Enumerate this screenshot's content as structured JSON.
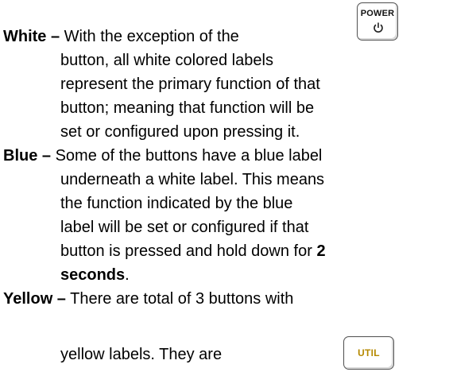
{
  "white": {
    "term": "White –",
    "text": " With the exception of the",
    "lines": [
      "button, all white colored labels",
      "represent the primary function of that",
      "button; meaning that function will be",
      "set or configured upon pressing it."
    ]
  },
  "blue": {
    "term": "Blue –",
    "text": " Some of the buttons have a blue label",
    "lines": [
      "underneath a white label.  This means",
      "the function indicated by the blue",
      "label will be set or configured if that"
    ],
    "hold_prefix": "button is pressed and hold down for ",
    "hold_bold": "2",
    "hold_bold_2": "seconds",
    "hold_end": "."
  },
  "yellow": {
    "term": "Yellow –",
    "text": " There are total of 3 buttons with",
    "line2": "yellow labels.  They are"
  },
  "power_button": {
    "label": "POWER",
    "icon": "power-icon"
  },
  "util_button": {
    "label": "UTIL",
    "label_color": "#b58900"
  }
}
